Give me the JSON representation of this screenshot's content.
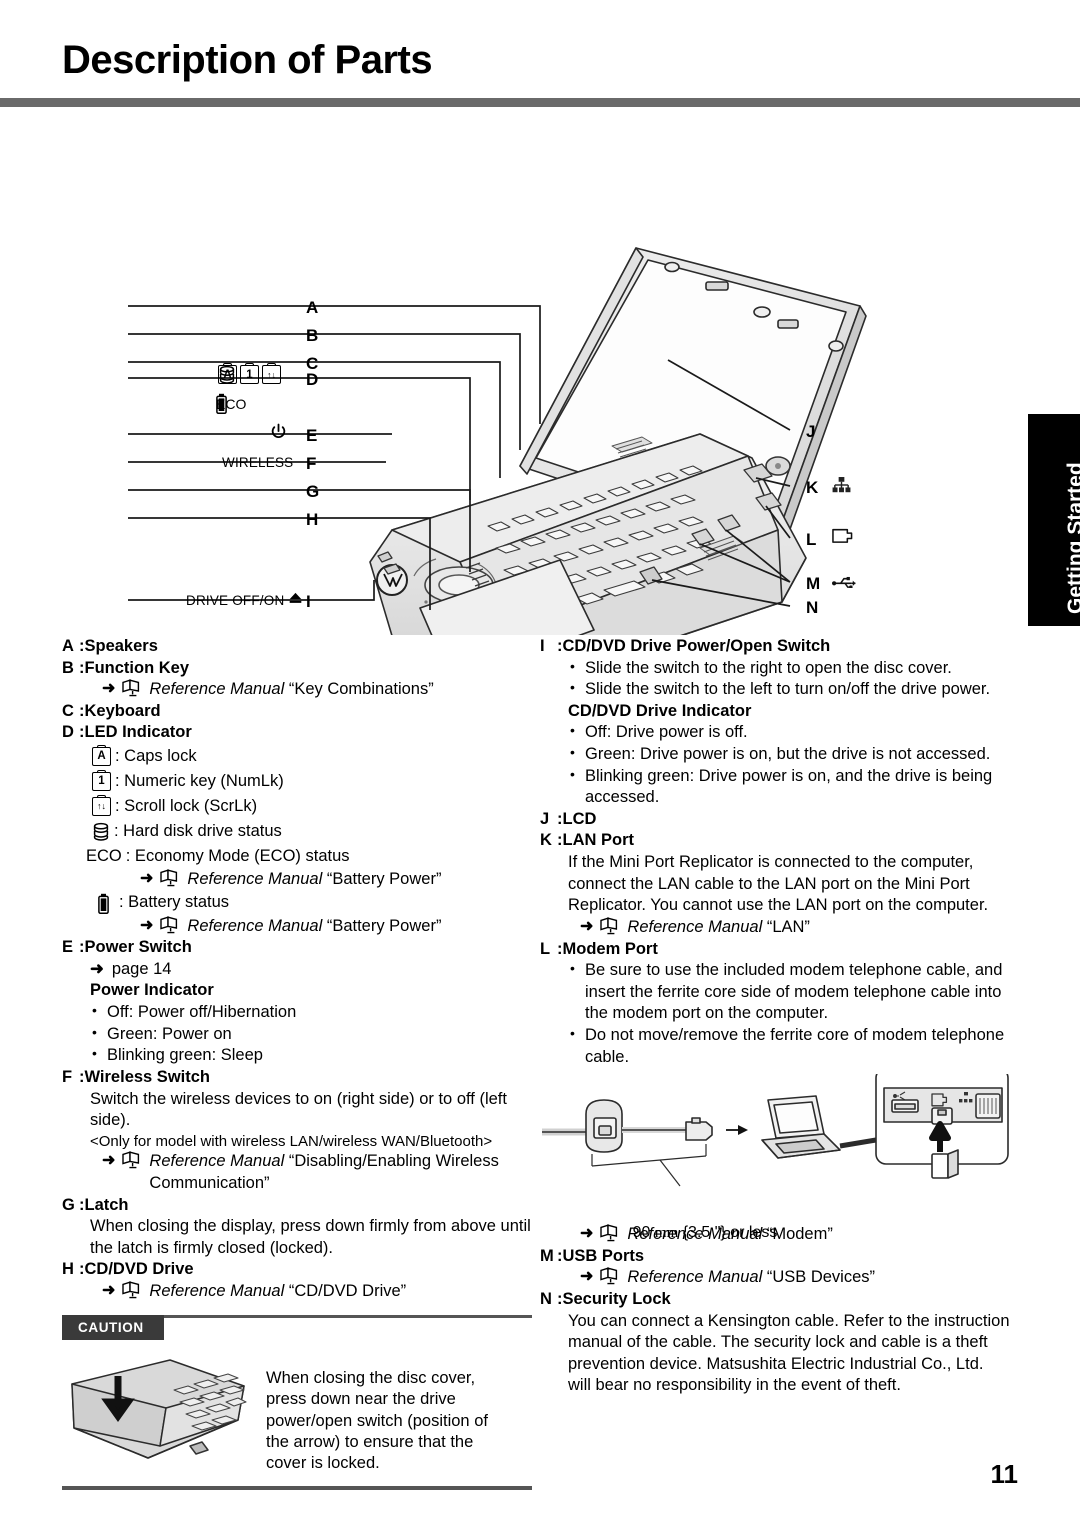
{
  "page": {
    "title": "Description of Parts",
    "number": "11",
    "side_tab": "Getting Started"
  },
  "diagram": {
    "callouts_left": [
      "A",
      "B",
      "C",
      "D",
      "E",
      "F",
      "G",
      "H",
      "I"
    ],
    "callouts_right": [
      "J",
      "K",
      "L",
      "M",
      "N"
    ],
    "led_panel": {
      "caps_glyph": "A",
      "num_glyph": "1",
      "scroll_glyph": "↑↓",
      "hdd_icon": "hard-disk-icon",
      "eco_label": "ECO",
      "battery_icon": "battery-icon"
    },
    "power_icon": "power-symbol-icon",
    "wireless_label": "WIRELESS",
    "drive_label": "DRIVE OFF/ON",
    "eject_icon": "eject-icon",
    "right_icons": {
      "lan": "lan-port-icon",
      "modem": "modem-port-icon",
      "usb": "usb-port-icon"
    }
  },
  "left_column": {
    "a": {
      "key": "A",
      "sep": ":",
      "label": "Speakers"
    },
    "b": {
      "key": "B",
      "sep": ":",
      "label": "Function Key"
    },
    "b_ref": {
      "arrow": "➜",
      "manual": "Reference Manual",
      "topic": "“Key Combinations”"
    },
    "c": {
      "key": "C",
      "sep": ":",
      "label": "Keyboard"
    },
    "d": {
      "key": "D",
      "sep": ":",
      "label": "LED Indicator"
    },
    "d_items": [
      {
        "glyph": "A",
        "type": "box",
        "text": ": Caps lock"
      },
      {
        "glyph": "1",
        "type": "box",
        "text": ": Numeric key (NumLk)"
      },
      {
        "glyph": "↑↓",
        "type": "box",
        "text": ": Scroll lock (ScrLk)"
      },
      {
        "glyph": "",
        "type": "hdd",
        "text": ": Hard disk drive status"
      }
    ],
    "eco_item": {
      "glyph": "ECO",
      "text": ": Economy Mode (ECO) status"
    },
    "eco_ref": {
      "arrow": "➜",
      "manual": "Reference Manual",
      "topic": "“Battery Power”"
    },
    "battery_item": {
      "text": ": Battery status"
    },
    "battery_ref": {
      "arrow": "➜",
      "manual": "Reference Manual",
      "topic": "“Battery Power”"
    },
    "e": {
      "key": "E",
      "sep": ":",
      "label": "Power Switch"
    },
    "e_page_ref": {
      "arrow": "➜",
      "text": "page 14"
    },
    "power_indicator_head": "Power Indicator",
    "power_indicator_bullets": [
      "Off: Power off/Hibernation",
      "Green: Power on",
      "Blinking green: Sleep"
    ],
    "f": {
      "key": "F",
      "sep": ":",
      "label": "Wireless Switch"
    },
    "f_body": "Switch the wireless devices to on (right side) or to off (left side).",
    "f_note": "<Only for model with wireless LAN/wireless WAN/Bluetooth>",
    "f_ref": {
      "arrow": "➜",
      "manual": "Reference Manual",
      "topic": "“Disabling/Enabling Wireless Communication”"
    },
    "g": {
      "key": "G",
      "sep": ":",
      "label": "Latch"
    },
    "g_body": "When closing the display, press down firmly from above until the latch is firmly closed (locked).",
    "h": {
      "key": "H",
      "sep": ":",
      "label": "CD/DVD Drive"
    },
    "h_ref": {
      "arrow": "➜",
      "manual": "Reference Manual",
      "topic": "“CD/DVD Drive”"
    },
    "caution": {
      "badge": "CAUTION",
      "text": "When closing the disc cover, press down near the drive power/open switch (position of the arrow) to ensure that the cover is locked."
    }
  },
  "right_column": {
    "i": {
      "key": "I",
      "sep": ":",
      "label": "CD/DVD Drive Power/Open Switch"
    },
    "i_bullets": [
      "Slide the switch to the right to open the disc cover.",
      "Slide the switch to the left to turn on/off the drive power."
    ],
    "cd_indicator_head": "CD/DVD Drive Indicator",
    "cd_indicator_bullets": [
      "Off: Drive power is off.",
      "Green: Drive power is on, but the drive is not accessed.",
      "Blinking green: Drive power is on, and the drive is being accessed."
    ],
    "j": {
      "key": "J",
      "sep": ":",
      "label": "LCD"
    },
    "k": {
      "key": "K",
      "sep": ":",
      "label": "LAN Port"
    },
    "k_body": "If the Mini Port Replicator is connected to the computer, connect the LAN cable to the LAN port on the Mini Port Replicator. You cannot use the LAN port on the computer.",
    "k_ref": {
      "arrow": "➜",
      "manual": "Reference Manual",
      "topic": "“LAN”"
    },
    "l": {
      "key": "L",
      "sep": ":",
      "label": "Modem Port"
    },
    "l_bullets": [
      "Be sure to use the included modem telephone cable, and insert the ferrite core side of modem telephone cable into the modem port on the computer.",
      "Do not move/remove the ferrite core of modem telephone cable."
    ],
    "modem_caption": {
      "value": "90",
      "unit": "mm",
      "imperial": "{3.5 \"} or less"
    },
    "l_ref": {
      "arrow": "➜",
      "manual": "Reference Manual",
      "topic": "“Modem”"
    },
    "m": {
      "key": "M",
      "sep": ":",
      "label": "USB Ports"
    },
    "m_ref": {
      "arrow": "➜",
      "manual": "Reference Manual",
      "topic": "“USB Devices”"
    },
    "n": {
      "key": "N",
      "sep": ":",
      "label": "Security Lock"
    },
    "n_body": "You can connect a Kensington cable. Refer to the instruction manual of the cable. The security lock and cable is a theft prevention device. Matsushita Electric Industrial Co., Ltd. will bear no responsibility in the event of theft."
  }
}
